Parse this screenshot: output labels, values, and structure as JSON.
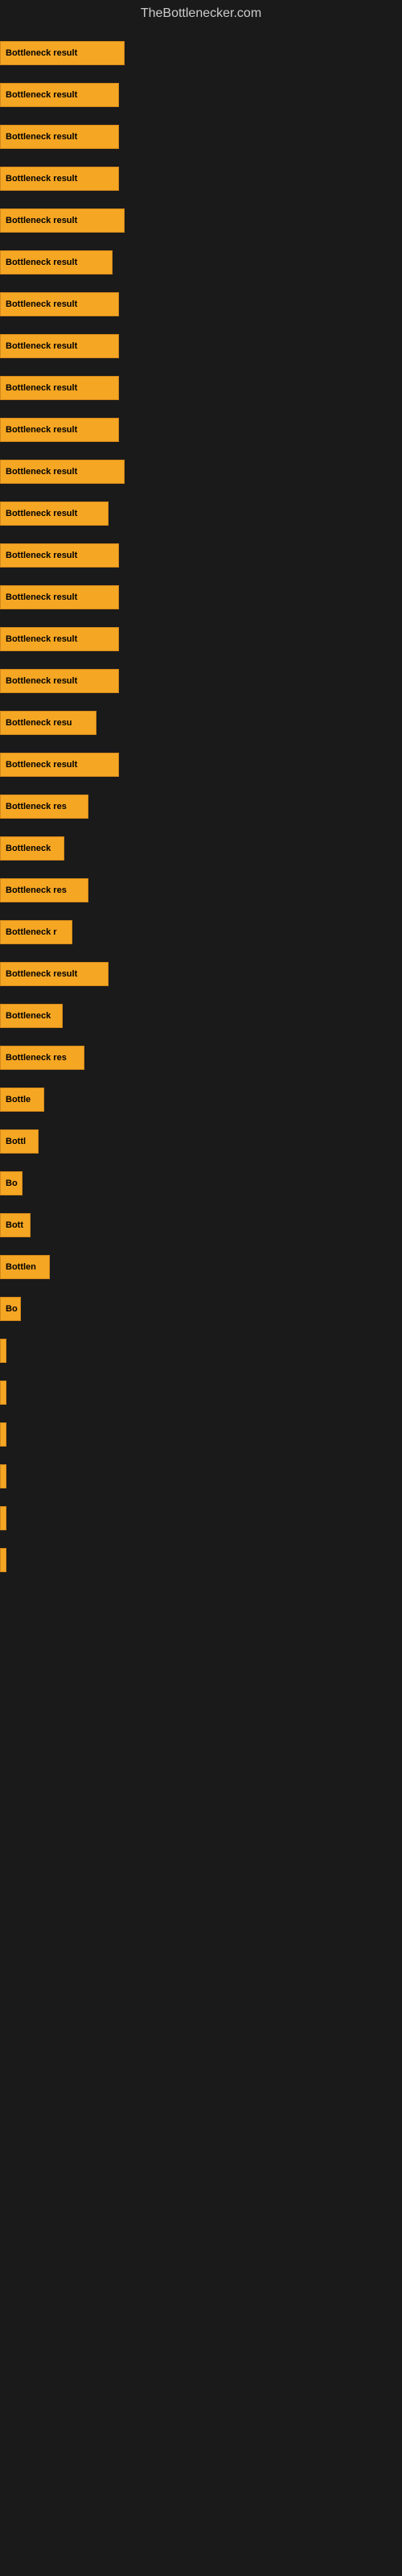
{
  "site": {
    "title": "TheBottlenecker.com"
  },
  "bars": [
    {
      "label": "Bottleneck result",
      "width": 155
    },
    {
      "label": "Bottleneck result",
      "width": 148
    },
    {
      "label": "Bottleneck result",
      "width": 148
    },
    {
      "label": "Bottleneck result",
      "width": 148
    },
    {
      "label": "Bottleneck result",
      "width": 155
    },
    {
      "label": "Bottleneck result",
      "width": 140
    },
    {
      "label": "Bottleneck result",
      "width": 148
    },
    {
      "label": "Bottleneck result",
      "width": 148
    },
    {
      "label": "Bottleneck result",
      "width": 148
    },
    {
      "label": "Bottleneck result",
      "width": 148
    },
    {
      "label": "Bottleneck result",
      "width": 155
    },
    {
      "label": "Bottleneck result",
      "width": 135
    },
    {
      "label": "Bottleneck result",
      "width": 148
    },
    {
      "label": "Bottleneck result",
      "width": 148
    },
    {
      "label": "Bottleneck result",
      "width": 148
    },
    {
      "label": "Bottleneck result",
      "width": 148
    },
    {
      "label": "Bottleneck resu",
      "width": 120
    },
    {
      "label": "Bottleneck result",
      "width": 148
    },
    {
      "label": "Bottleneck res",
      "width": 110
    },
    {
      "label": "Bottleneck",
      "width": 80
    },
    {
      "label": "Bottleneck res",
      "width": 110
    },
    {
      "label": "Bottleneck r",
      "width": 90
    },
    {
      "label": "Bottleneck result",
      "width": 135
    },
    {
      "label": "Bottleneck",
      "width": 78
    },
    {
      "label": "Bottleneck res",
      "width": 105
    },
    {
      "label": "Bottle",
      "width": 55
    },
    {
      "label": "Bottl",
      "width": 48
    },
    {
      "label": "Bo",
      "width": 28
    },
    {
      "label": "Bott",
      "width": 38
    },
    {
      "label": "Bottlen",
      "width": 62
    },
    {
      "label": "Bo",
      "width": 26
    },
    {
      "label": "",
      "width": 8
    },
    {
      "label": "",
      "width": 6
    },
    {
      "label": "",
      "width": 4
    },
    {
      "label": "",
      "width": 3
    },
    {
      "label": "",
      "width": 3
    },
    {
      "label": "",
      "width": 3
    }
  ],
  "colors": {
    "bar_fill": "#f5a623",
    "bar_border": "#d4891a",
    "background": "#1a1a1a",
    "text": "#000000",
    "title": "#cccccc"
  }
}
